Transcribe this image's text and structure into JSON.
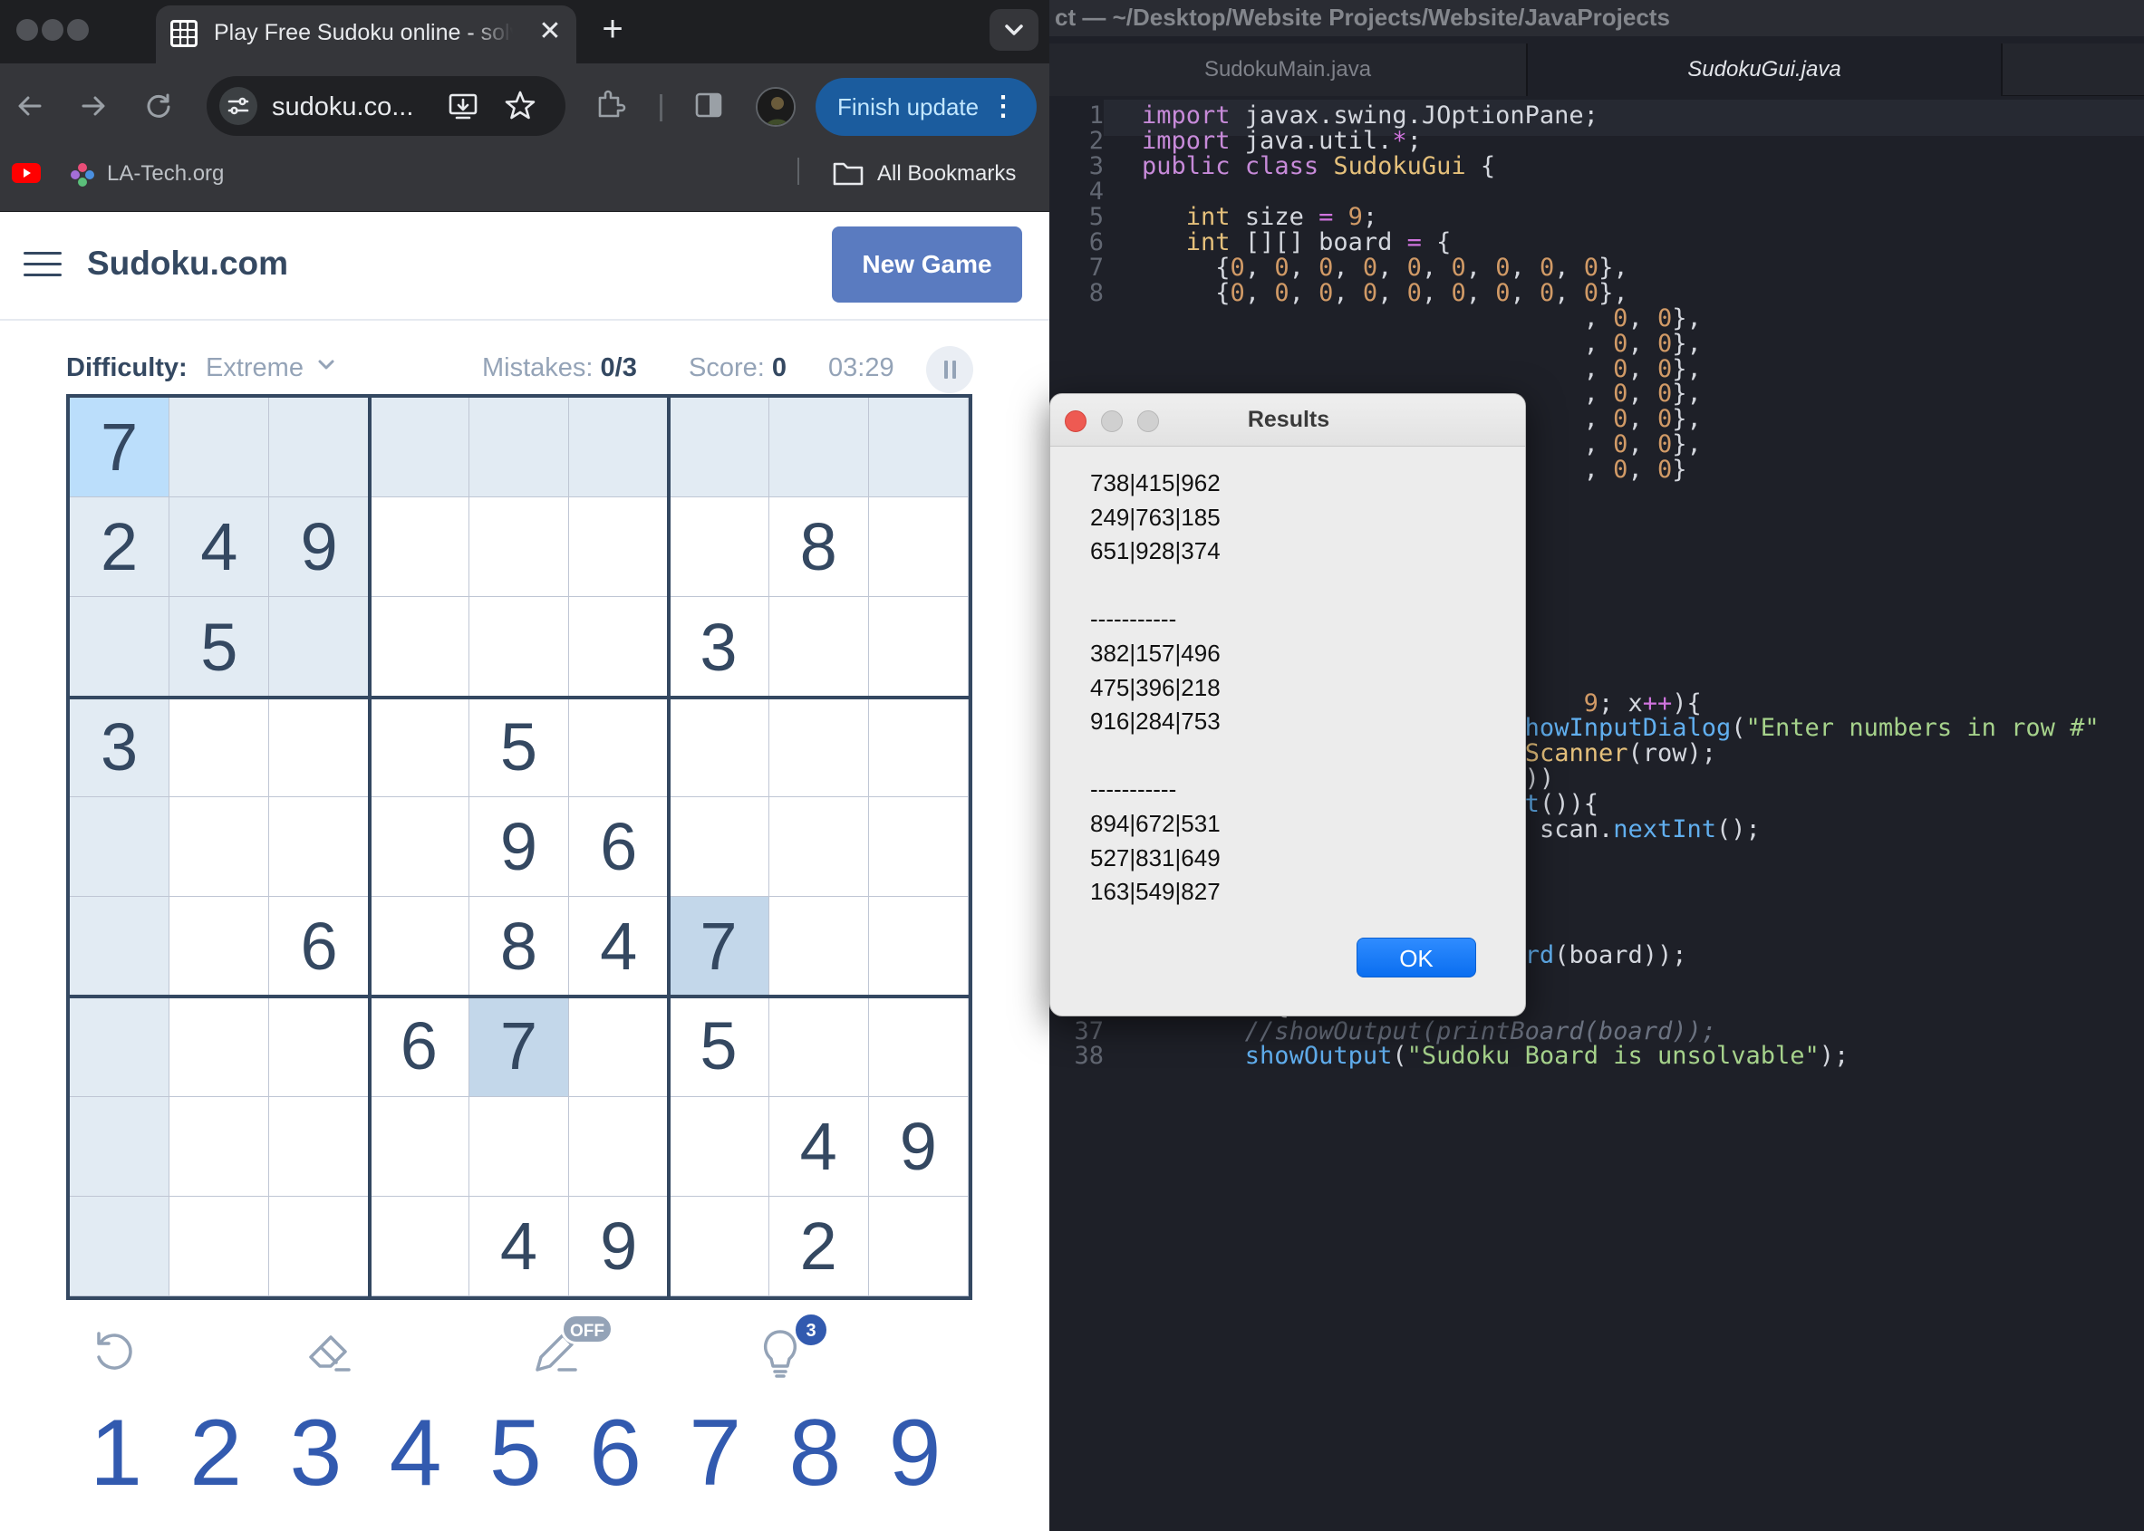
{
  "browser": {
    "tab_title": "Play Free Sudoku online - solve web sudoku puzzles",
    "url": "sudoku.co...",
    "finish_update_label": "Finish update",
    "bookmarks": [
      {
        "label": "",
        "icon": "youtube-icon"
      },
      {
        "label": "LA-Tech.org",
        "icon": "latech-icon"
      }
    ],
    "all_bookmarks_label": "All Bookmarks"
  },
  "sudoku": {
    "logo": "Sudoku.com",
    "new_game_label": "New Game",
    "difficulty_label": "Difficulty:",
    "difficulty_value": "Extreme",
    "mistakes_label": "Mistakes:",
    "mistakes_value": "0/3",
    "score_label": "Score:",
    "score_value": "0",
    "timer": "03:29",
    "grid": [
      [
        7,
        0,
        0,
        0,
        0,
        0,
        0,
        0,
        0
      ],
      [
        2,
        4,
        9,
        0,
        0,
        0,
        0,
        8,
        0
      ],
      [
        0,
        5,
        0,
        0,
        0,
        0,
        3,
        0,
        0
      ],
      [
        3,
        0,
        0,
        0,
        5,
        0,
        0,
        0,
        0
      ],
      [
        0,
        0,
        0,
        0,
        9,
        6,
        0,
        0,
        0
      ],
      [
        0,
        0,
        6,
        0,
        8,
        4,
        7,
        0,
        0
      ],
      [
        0,
        0,
        0,
        6,
        7,
        0,
        5,
        0,
        0
      ],
      [
        0,
        0,
        0,
        0,
        0,
        0,
        0,
        4,
        9
      ],
      [
        0,
        0,
        0,
        0,
        4,
        9,
        0,
        2,
        0
      ]
    ],
    "selected_cell": {
      "row": 0,
      "col": 0
    },
    "tools": [
      {
        "name": "undo",
        "icon": "undo-icon"
      },
      {
        "name": "erase",
        "icon": "eraser-icon"
      },
      {
        "name": "notes",
        "icon": "pencil-icon",
        "badge": "OFF"
      },
      {
        "name": "hint",
        "icon": "lightbulb-icon",
        "badge": "3"
      }
    ],
    "numpad": [
      "1",
      "2",
      "3",
      "4",
      "5",
      "6",
      "7",
      "8",
      "9"
    ]
  },
  "editor": {
    "window_title": "ct — ~/Desktop/Website Projects/Website/JavaProjects",
    "tabs": [
      "SudokuMain.java",
      "SudokuGui.java"
    ],
    "active_tab": "SudokuGui.java"
  },
  "dialog": {
    "title": "Results",
    "lines": [
      "738|415|962",
      "249|763|185",
      "651|928|374",
      "",
      "-----------",
      "382|157|496",
      "475|396|218",
      "916|284|753",
      "",
      "-----------",
      "894|672|531",
      "527|831|649",
      "163|549|827"
    ],
    "ok_label": "OK"
  },
  "colors": {
    "sudoku_primary": "#344861",
    "sudoku_accent": "#325aaf",
    "new_game_button": "#5a7bc0",
    "highlight": "#e2ebf3",
    "selected": "#bbdefb",
    "same_number": "#c3d7ea"
  }
}
